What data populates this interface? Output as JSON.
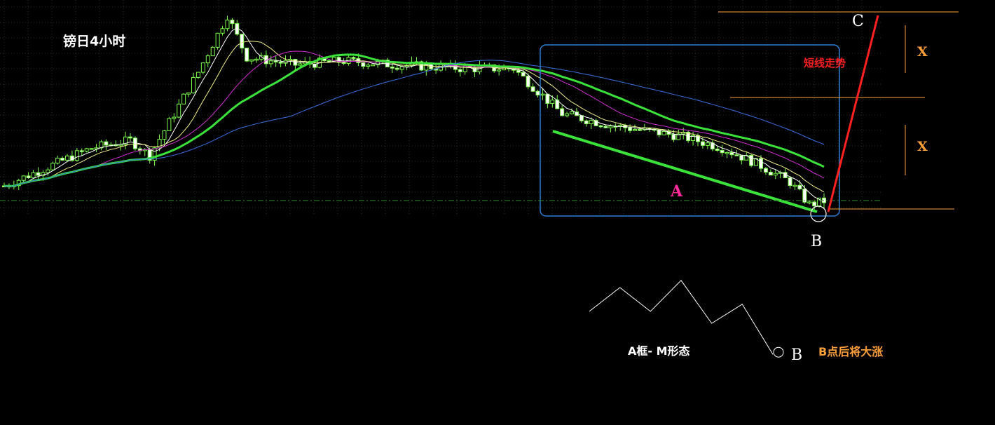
{
  "title": "镑日4小时",
  "annotations": {
    "box_label": "A",
    "point_b": "B",
    "point_c": "C",
    "x_upper": "X",
    "x_lower": "X",
    "short_trend": "短线走势",
    "pattern_note": "A框- M形态",
    "pattern_b": "B",
    "after_b_note": "B点后将大涨"
  },
  "colors": {
    "background": "#000000",
    "candle_bull_fill": "#000000",
    "candle_bear_fill": "#ffffff",
    "candle_outline": "#7cff4a",
    "ma_fast": "#ffffff",
    "ma_yellow": "#f5f08a",
    "ma_magenta": "#d22fd2",
    "ma_green_thick": "#3ae23a",
    "ma_blue": "#3a6fe0",
    "box_border": "#2e7fd6",
    "channel_line": "#3ae23a",
    "projection_line": "#ff2020",
    "level_lines": "#ff9f3a",
    "dashdot_line": "#2e8b2e",
    "grid": "#1f3a1f"
  },
  "chart_data": {
    "type": "candlestick",
    "title": "镑日4小时",
    "xlabel": "",
    "ylabel": "",
    "grid": true,
    "candle_count": 170,
    "price_path_keypoints": [
      [
        0,
        0.1
      ],
      [
        18,
        0.3
      ],
      [
        26,
        0.34
      ],
      [
        30,
        0.26
      ],
      [
        40,
        0.7
      ],
      [
        46,
        1.0
      ],
      [
        50,
        0.78
      ],
      [
        60,
        0.74
      ],
      [
        70,
        0.76
      ],
      [
        80,
        0.74
      ],
      [
        95,
        0.72
      ],
      [
        105,
        0.72
      ],
      [
        110,
        0.6
      ],
      [
        115,
        0.48
      ],
      [
        125,
        0.42
      ],
      [
        140,
        0.36
      ],
      [
        148,
        0.3
      ],
      [
        155,
        0.22
      ],
      [
        162,
        0.12
      ],
      [
        166,
        0.0
      ],
      [
        169,
        0.02
      ]
    ],
    "moving_averages": [
      {
        "name": "",
        "period": 5,
        "color": "#ffffff",
        "width": 1
      },
      {
        "name": "",
        "period": 10,
        "color": "#f5f08a",
        "width": 1
      },
      {
        "name": "",
        "period": 20,
        "color": "#d22fd2",
        "width": 1
      },
      {
        "name": "",
        "period": 30,
        "color": "#3ae23a",
        "width": 3
      },
      {
        "name": "",
        "period": 60,
        "color": "#3a6fe0",
        "width": 1
      }
    ],
    "pattern_sketch": {
      "type": "line",
      "description_label": "A框- M形态",
      "points": [
        [
          0,
          0.0
        ],
        [
          1,
          1.0
        ],
        [
          2,
          0.0
        ],
        [
          3,
          1.3
        ],
        [
          4,
          -0.5
        ],
        [
          5,
          0.3
        ],
        [
          6,
          -1.8
        ]
      ]
    }
  }
}
